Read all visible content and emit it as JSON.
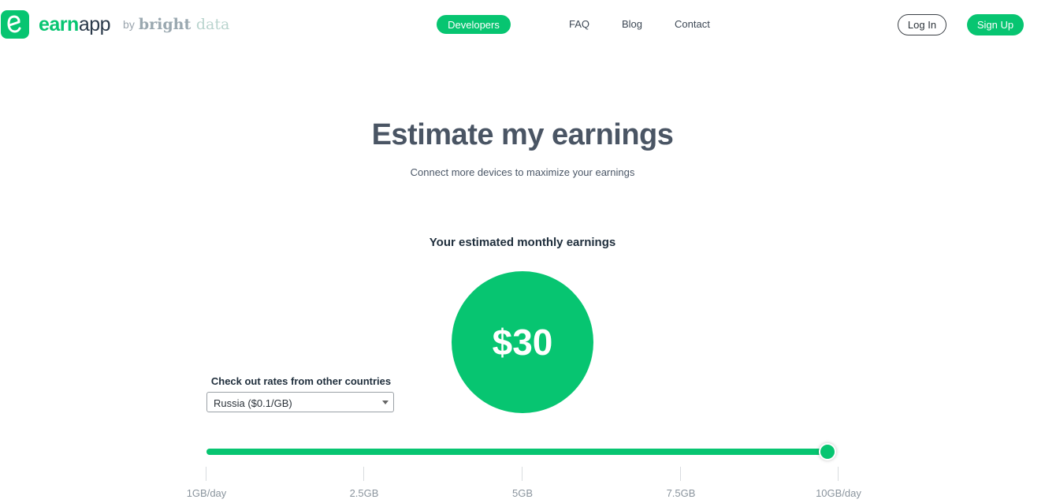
{
  "header": {
    "logo_icon": "earnapp-e-icon",
    "logo_earn": "earn",
    "logo_app": "app",
    "by": "by",
    "brand_bright": "bright",
    "brand_data": "data",
    "nav": {
      "developers": "Developers",
      "faq": "FAQ",
      "blog": "Blog",
      "contact": "Contact"
    },
    "login": "Log In",
    "signup": "Sign Up"
  },
  "hero": {
    "title": "Estimate my earnings",
    "subtitle": "Connect more devices to maximize your earnings"
  },
  "estimate": {
    "label": "Your estimated monthly earnings",
    "amount": "$30"
  },
  "country": {
    "label": "Check out rates from other countries",
    "selected": "Russia ($0.1/GB)"
  },
  "slider": {
    "value_fraction": 0.99,
    "ticks": [
      "1GB/day",
      "2.5GB",
      "5GB",
      "7.5GB",
      "10GB/day"
    ]
  },
  "colors": {
    "accent": "#07c571",
    "heading": "#4a5564",
    "dark_text": "#1e2d3b"
  }
}
